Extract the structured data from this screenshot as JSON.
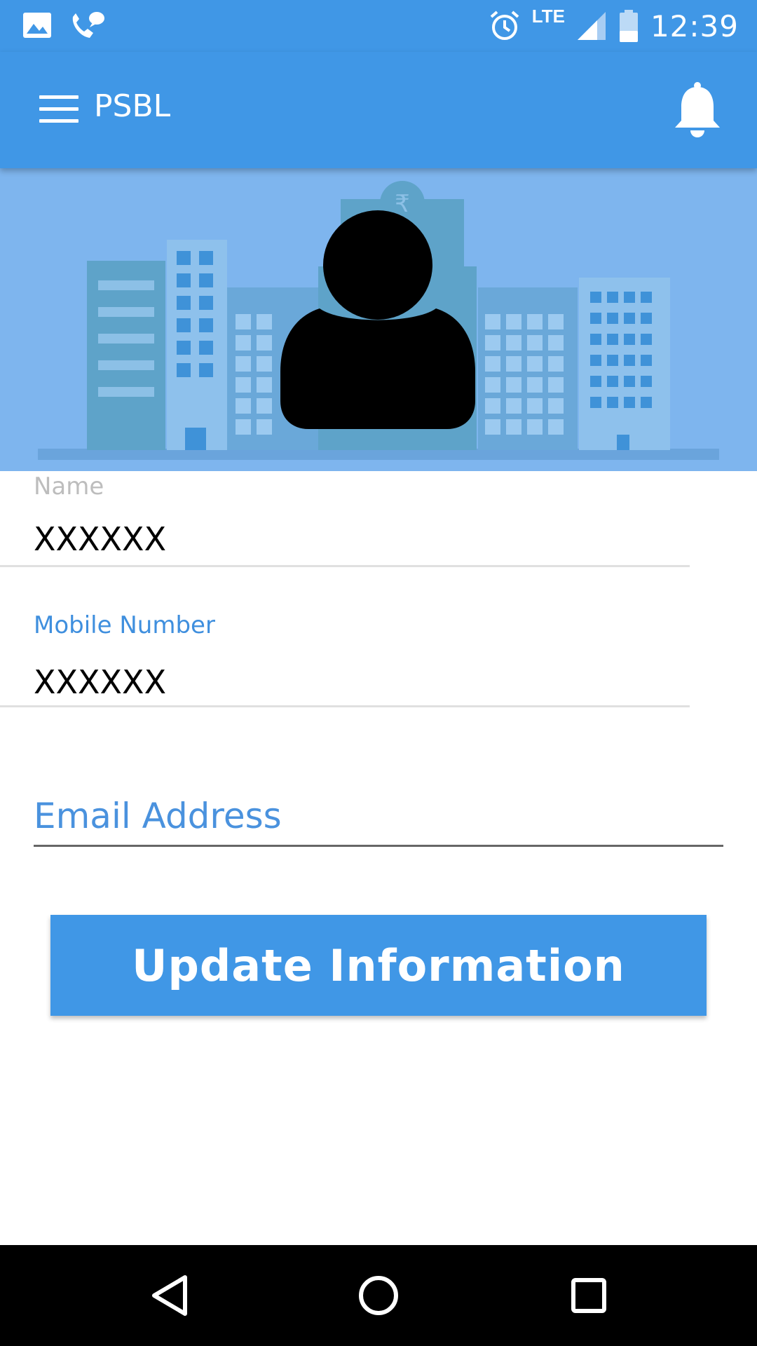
{
  "status_bar": {
    "time": "12:39",
    "network": "LTE",
    "icons": [
      "image-icon",
      "wifi-call-icon",
      "alarm-icon",
      "signal-icon",
      "battery-icon"
    ]
  },
  "app_bar": {
    "title": "PSBL",
    "menu_icon": "menu-icon",
    "bell_icon": "bell-icon",
    "color": "#4097e6"
  },
  "form": {
    "name": {
      "label": "Name",
      "value": "XXXXXX"
    },
    "mobile": {
      "label": "Mobile Number",
      "value": "XXXXXX"
    },
    "email": {
      "placeholder": "Email Address",
      "value": ""
    }
  },
  "update_button": {
    "label": "Update Information"
  },
  "nav_bar": {
    "buttons": [
      "back-icon",
      "home-icon",
      "recents-icon"
    ]
  }
}
